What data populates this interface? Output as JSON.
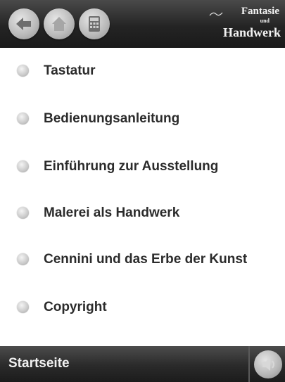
{
  "header": {
    "buttons": [
      {
        "icon": "back-arrow-icon"
      },
      {
        "icon": "home-icon"
      },
      {
        "icon": "calculator-icon"
      }
    ],
    "logo": {
      "line1": "Fantasie",
      "line2": "und",
      "line3": "Handwerk"
    }
  },
  "menu": {
    "items": [
      {
        "label": "Tastatur"
      },
      {
        "label": "Bedienungsanleitung"
      },
      {
        "label": "Einführung zur Ausstellung"
      },
      {
        "label": "Malerei als Handwerk"
      },
      {
        "label": "Cennini und das Erbe der Kunst"
      },
      {
        "label": "Copyright"
      }
    ]
  },
  "footer": {
    "title": "Startseite",
    "sound_icon": "speaker-icon"
  },
  "colors": {
    "bar": "#2a2a2a",
    "text": "#2b2b2b",
    "button": "#b8b8b8"
  }
}
